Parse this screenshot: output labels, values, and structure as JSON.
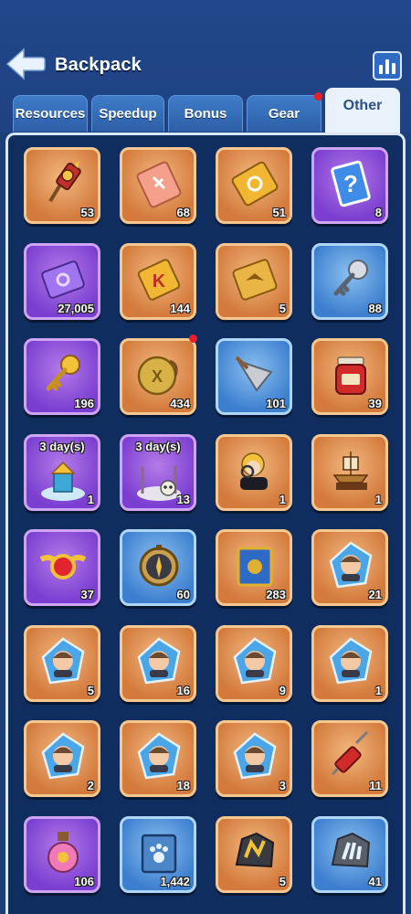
{
  "header": {
    "title": "Backpack",
    "back_icon": "back-arrow-icon",
    "stats_icon": "bar-chart-icon"
  },
  "tabs": [
    {
      "label": "Resources",
      "active": false,
      "badge": false
    },
    {
      "label": "Speedup",
      "active": false,
      "badge": false
    },
    {
      "label": "Bonus",
      "active": false,
      "badge": false
    },
    {
      "label": "Gear",
      "active": false,
      "badge": true
    },
    {
      "label": "Other",
      "active": true,
      "badge": false
    }
  ],
  "items": [
    {
      "icon": "firework-rocket-icon",
      "frame": "orange",
      "qty": "53"
    },
    {
      "icon": "pink-ticket-icon",
      "frame": "orange",
      "qty": "68"
    },
    {
      "icon": "gold-ticket-icon",
      "frame": "orange",
      "qty": "51"
    },
    {
      "icon": "mystery-card-icon",
      "frame": "purple",
      "qty": "8"
    },
    {
      "icon": "purple-ticket-icon",
      "frame": "purple",
      "qty": "27,005"
    },
    {
      "icon": "gold-k-ticket-icon",
      "frame": "orange",
      "qty": "144"
    },
    {
      "icon": "gold-bird-ticket-icon",
      "frame": "orange",
      "qty": "5"
    },
    {
      "icon": "silver-key-icon",
      "frame": "blue",
      "qty": "88"
    },
    {
      "icon": "gold-key-icon",
      "frame": "purple",
      "qty": "196"
    },
    {
      "icon": "gold-tag-icon",
      "frame": "orange",
      "qty": "434",
      "badge": true
    },
    {
      "icon": "quill-pen-icon",
      "frame": "blue",
      "qty": "101"
    },
    {
      "icon": "jam-jar-icon",
      "frame": "orange",
      "qty": "39"
    },
    {
      "icon": "castle-skin-icon",
      "frame": "purple",
      "qty": "1",
      "duration": "3 day(s)"
    },
    {
      "icon": "skull-gate-icon",
      "frame": "purple",
      "qty": "13",
      "duration": "3 day(s)"
    },
    {
      "icon": "detective-avatar-icon",
      "frame": "orange",
      "qty": "1"
    },
    {
      "icon": "ship-model-icon",
      "frame": "orange",
      "qty": "1"
    },
    {
      "icon": "winged-medal-icon",
      "frame": "purple",
      "qty": "37"
    },
    {
      "icon": "compass-icon",
      "frame": "blue",
      "qty": "60"
    },
    {
      "icon": "blue-book-icon",
      "frame": "orange",
      "qty": "283"
    },
    {
      "icon": "hero-shard-icon",
      "frame": "orange",
      "qty": "21"
    },
    {
      "icon": "hero-shard-icon",
      "frame": "orange",
      "qty": "5"
    },
    {
      "icon": "hero-shard-icon",
      "frame": "orange",
      "qty": "16"
    },
    {
      "icon": "hero-shard-icon",
      "frame": "orange",
      "qty": "9"
    },
    {
      "icon": "hero-shard-icon",
      "frame": "orange",
      "qty": "1"
    },
    {
      "icon": "hero-shard-icon",
      "frame": "orange",
      "qty": "2"
    },
    {
      "icon": "hero-shard-icon",
      "frame": "orange",
      "qty": "18"
    },
    {
      "icon": "hero-shard-icon",
      "frame": "orange",
      "qty": "3"
    },
    {
      "icon": "syringe-icon",
      "frame": "orange",
      "qty": "11"
    },
    {
      "icon": "pink-potion-icon",
      "frame": "purple",
      "qty": "106"
    },
    {
      "icon": "paw-book-icon",
      "frame": "blue",
      "qty": "1,442"
    },
    {
      "icon": "gold-ore-icon",
      "frame": "orange",
      "qty": "5"
    },
    {
      "icon": "silver-ore-icon",
      "frame": "blue",
      "qty": "41"
    }
  ],
  "colors": {
    "background": "#1d3f78",
    "panel": "#0f2d5e",
    "frame_orange": "#d37a3c",
    "frame_purple": "#7a3fd0",
    "frame_blue": "#3d7fcf",
    "badge_red": "#e8202a"
  }
}
